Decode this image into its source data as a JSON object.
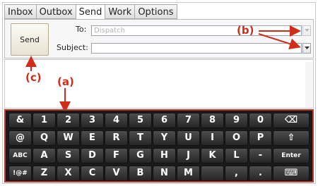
{
  "tabs": [
    "Inbox",
    "Outbox",
    "Send",
    "Work",
    "Options"
  ],
  "active_tab": "Send",
  "header": {
    "send_label": "Send",
    "to_label": "To:",
    "to_value": "Dispatch",
    "subject_label": "Subject:",
    "subject_value": ""
  },
  "callouts": {
    "a": "(a)",
    "b": "(b)",
    "c": "(c)"
  },
  "keyboard": {
    "rows": [
      [
        "&",
        "1",
        "2",
        "3",
        "4",
        "5",
        "6",
        "7",
        "8",
        "9",
        "0",
        "⌫"
      ],
      [
        "@",
        "Q",
        "W",
        "E",
        "R",
        "T",
        "Y",
        "U",
        "I",
        "O",
        "P",
        "⇧"
      ],
      [
        "ABC",
        "A",
        "S",
        "D",
        "F",
        "G",
        "H",
        "J",
        "K",
        "L",
        "-",
        "Enter"
      ],
      [
        "!@#",
        "Z",
        "X",
        "C",
        "V",
        "B",
        "N",
        "M",
        "",
        ",",
        ".",
        "⌨"
      ]
    ]
  },
  "colors": {
    "callout": "#d12b1a",
    "keyboard_bg": "#1a1a1a",
    "keyboard_border": "#c0392b"
  }
}
